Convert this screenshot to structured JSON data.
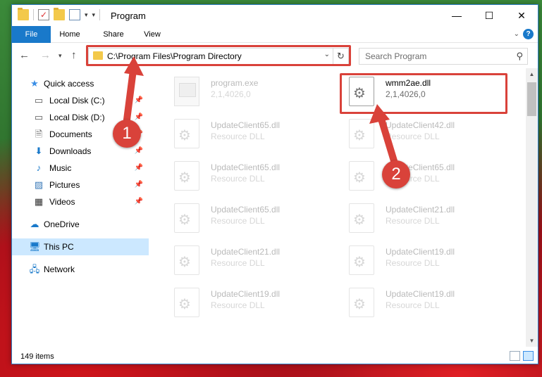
{
  "window": {
    "title": "Program",
    "buttons": {
      "minimize": "—",
      "maximize": "☐",
      "close": "✕"
    }
  },
  "ribbon": {
    "tabs": [
      "File",
      "Home",
      "Share",
      "View"
    ],
    "help": "?"
  },
  "navigation": {
    "address": "C:\\Program Files\\Program Directory",
    "search_placeholder": "Search Program"
  },
  "sidebar": {
    "items": [
      {
        "label": "Quick access",
        "icon": "star-icon",
        "pinned": false
      },
      {
        "label": "Local Disk (C:)",
        "icon": "drive-icon",
        "pinned": true
      },
      {
        "label": "Local Disk (D:)",
        "icon": "drive-icon",
        "pinned": true
      },
      {
        "label": "Documents",
        "icon": "document-icon",
        "pinned": true
      },
      {
        "label": "Downloads",
        "icon": "download-icon",
        "pinned": true
      },
      {
        "label": "Music",
        "icon": "music-icon",
        "pinned": true
      },
      {
        "label": "Pictures",
        "icon": "pictures-icon",
        "pinned": true
      },
      {
        "label": "Videos",
        "icon": "videos-icon",
        "pinned": true
      },
      {
        "label": "OneDrive",
        "icon": "cloud-icon",
        "pinned": false
      },
      {
        "label": "This PC",
        "icon": "computer-icon",
        "pinned": false,
        "selected": true
      },
      {
        "label": "Network",
        "icon": "network-icon",
        "pinned": false
      }
    ]
  },
  "files": [
    {
      "name": "program.exe",
      "sub": "2,1,4026,0",
      "type": "exe",
      "faded": true
    },
    {
      "name": "wmm2ae.dll",
      "sub": "2,1,4026,0",
      "type": "dll",
      "faded": false
    },
    {
      "name": "UpdateClient65.dll",
      "sub": "Resource DLL",
      "type": "dll",
      "faded": true
    },
    {
      "name": "UpdateClient42.dll",
      "sub": "Resource DLL",
      "type": "dll",
      "faded": true
    },
    {
      "name": "UpdateClient65.dll",
      "sub": "Resource DLL",
      "type": "dll",
      "faded": true
    },
    {
      "name": "UpdateClient65.dll",
      "sub": "Resource DLL",
      "type": "dll",
      "faded": true
    },
    {
      "name": "UpdateClient65.dll",
      "sub": "Resource DLL",
      "type": "dll",
      "faded": true
    },
    {
      "name": "UpdateClient21.dll",
      "sub": "Resource DLL",
      "type": "dll",
      "faded": true
    },
    {
      "name": "UpdateClient21.dll",
      "sub": "Resource DLL",
      "type": "dll",
      "faded": true
    },
    {
      "name": "UpdateClient19.dll",
      "sub": "Resource DLL",
      "type": "dll",
      "faded": true
    },
    {
      "name": "UpdateClient19.dll",
      "sub": "Resource DLL",
      "type": "dll",
      "faded": true
    },
    {
      "name": "UpdateClient19.dll",
      "sub": "Resource DLL",
      "type": "dll",
      "faded": true
    }
  ],
  "status": {
    "item_count": "149 items"
  },
  "callouts": {
    "one": "1",
    "two": "2",
    "color": "#d9423a"
  }
}
